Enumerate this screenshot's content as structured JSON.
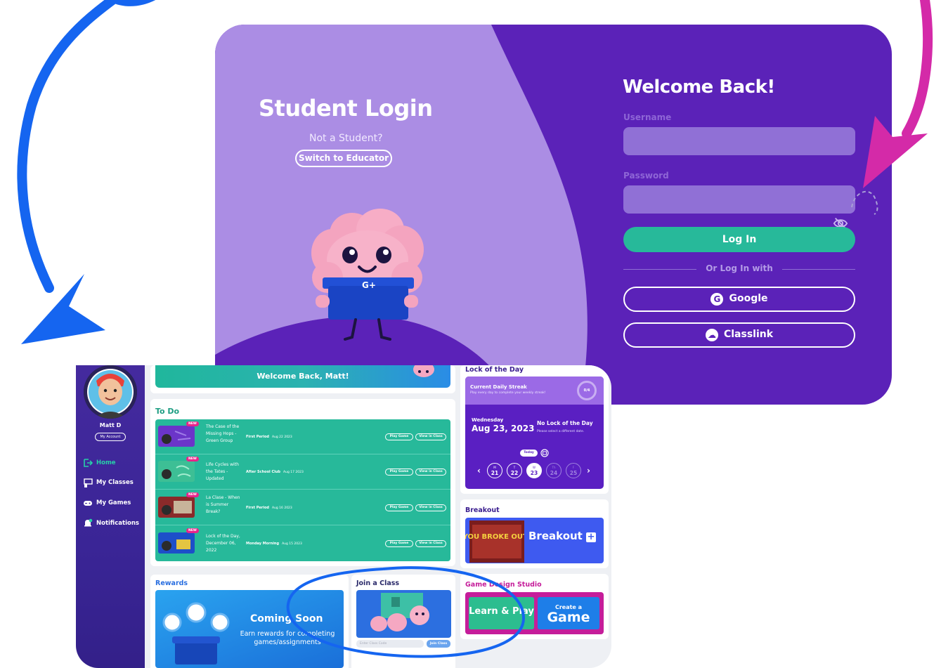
{
  "login": {
    "title": "Student Login",
    "not_student": "Not a Student?",
    "switch_label": "Switch to Educator",
    "welcome": "Welcome Back!",
    "username_label": "Username",
    "password_label": "Password",
    "login_label": "Log In",
    "or_text": "Or Log In with",
    "google_label": "Google",
    "classlink_label": "Classlink"
  },
  "dashboard": {
    "welcome_banner": "Welcome Back, Matt!",
    "user": {
      "name": "Matt D",
      "account_label": "My Account"
    },
    "nav": [
      {
        "label": "Home",
        "icon": "home-icon",
        "active": true
      },
      {
        "label": "My Classes",
        "icon": "classes-icon",
        "active": false
      },
      {
        "label": "My Games",
        "icon": "gamepad-icon",
        "active": false
      },
      {
        "label": "Notifications",
        "icon": "bell-icon",
        "active": false
      }
    ],
    "todo": {
      "title": "To Do",
      "badge": "NEW",
      "play_label": "Play Game",
      "view_label": "View in Class",
      "items": [
        {
          "name": "The Case of the Missing Hops - Green Group",
          "class": "First Period",
          "date": "Aug 22 2023"
        },
        {
          "name": "Life Cycles with the Tates - Updated",
          "class": "After School Club",
          "date": "Aug 17 2023"
        },
        {
          "name": "La Clase - When is Summer Break?",
          "class": "First Period",
          "date": "Aug 16 2023"
        },
        {
          "name": "Lock of the Day, December 06, 2022",
          "class": "Monday Morning",
          "date": "Aug 15 2023"
        }
      ]
    },
    "rewards": {
      "title": "Rewards",
      "heading": "Coming Soon",
      "sub": "Earn rewards for completing games/assignments"
    },
    "join": {
      "title": "Join a Class",
      "placeholder": "Enter Class Code",
      "button": "Join Class"
    },
    "lock": {
      "title": "Lock of the Day",
      "streak_title": "Current Daily Streak",
      "streak_sub": "Play every day to complete your weekly streak!",
      "streak_count": "0/4",
      "day": "Wednesday",
      "date": "Aug 23, 2023",
      "nolock_title": "No Lock of the Day",
      "nolock_sub": "Please select a different date.",
      "today": "Today",
      "days": [
        {
          "letter": "M",
          "num": "21"
        },
        {
          "letter": "T",
          "num": "22"
        },
        {
          "letter": "W",
          "num": "23"
        },
        {
          "letter": "Th",
          "num": "24"
        },
        {
          "letter": "F",
          "num": "25"
        }
      ]
    },
    "breakout": {
      "title": "Breakout",
      "banner": "Breakout",
      "image_text": "YOU BROKE OUT!"
    },
    "gds": {
      "title": "Game Design Studio",
      "create_small": "Create a",
      "create_big": "Game",
      "learn_text": "Learn & Play"
    }
  },
  "colors": {
    "login_dark": "#5b22b8",
    "login_light": "#ab8de4",
    "login_button": "#27b99a",
    "sidebar": "#3a2596",
    "todo_green": "#27b99a",
    "lock_purple": "#5a1fc2",
    "arrow_blue": "#1565f0",
    "arrow_magenta": "#d42aa8"
  }
}
